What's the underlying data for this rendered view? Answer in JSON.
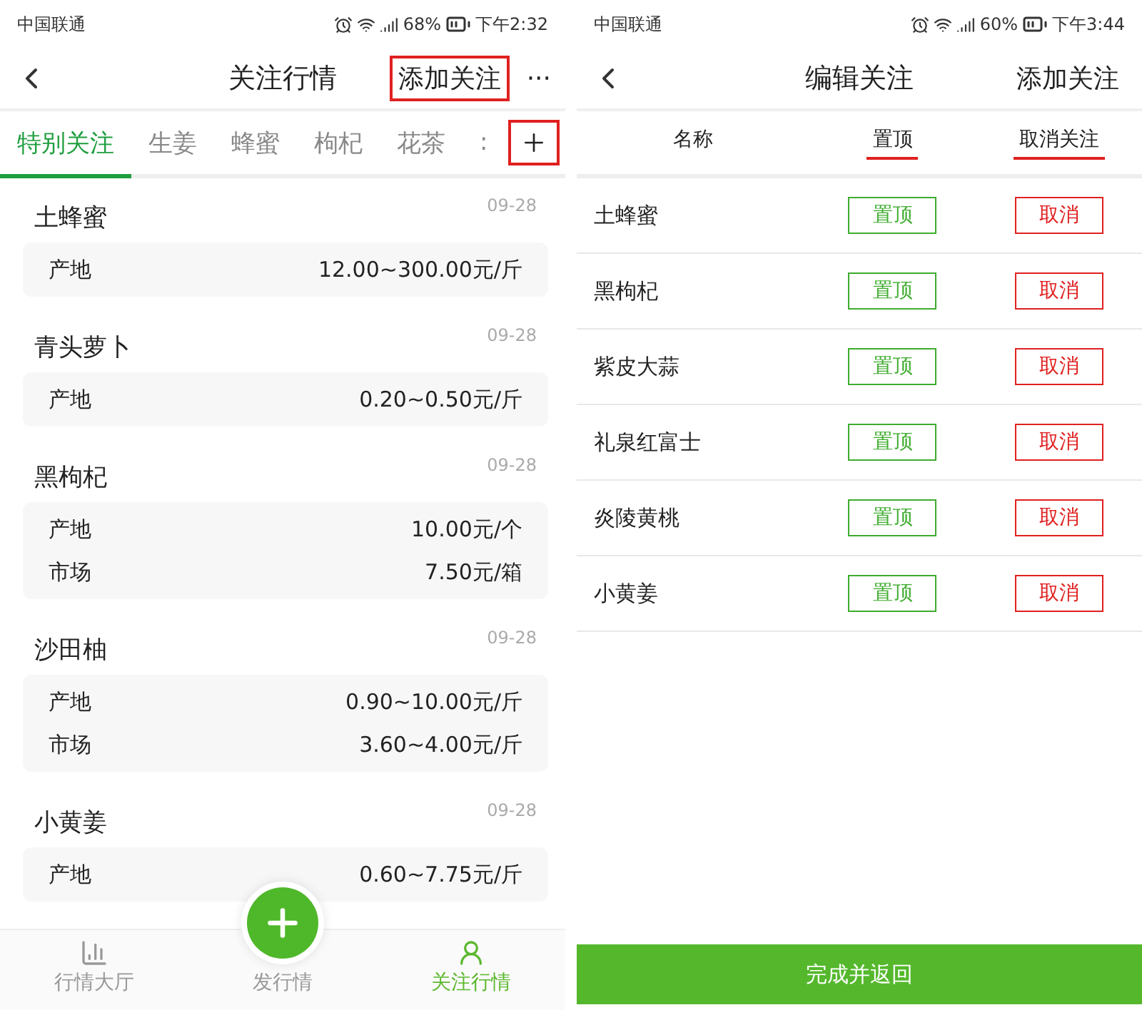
{
  "left": {
    "status_bar": {
      "carrier": "中国联通",
      "battery": "68%",
      "time": "下午2:32"
    },
    "header": {
      "title": "关注行情",
      "action": {
        "label": "添加关注",
        "highlighted": true
      },
      "more": "···"
    },
    "tabs": [
      {
        "label": "特别关注",
        "selected": true
      },
      {
        "label": "生姜",
        "selected": false
      },
      {
        "label": "蜂蜜",
        "selected": false
      },
      {
        "label": "枸杞",
        "selected": false
      },
      {
        "label": "花茶",
        "selected": false
      },
      {
        "label": ":",
        "selected": false
      }
    ],
    "add_tab": {
      "highlighted": true
    },
    "items": [
      {
        "name": "土蜂蜜",
        "date": "09-28",
        "prices": [
          {
            "label": "产地",
            "value": "12.00~300.00元/斤"
          }
        ]
      },
      {
        "name": "青头萝卜",
        "date": "09-28",
        "prices": [
          {
            "label": "产地",
            "value": "0.20~0.50元/斤"
          }
        ]
      },
      {
        "name": "黑枸杞",
        "date": "09-28",
        "prices": [
          {
            "label": "产地",
            "value": "10.00元/个"
          },
          {
            "label": "市场",
            "value": "7.50元/箱"
          }
        ]
      },
      {
        "name": "沙田柚",
        "date": "09-28",
        "prices": [
          {
            "label": "产地",
            "value": "0.90~10.00元/斤"
          },
          {
            "label": "市场",
            "value": "3.60~4.00元/斤"
          }
        ]
      },
      {
        "name": "小黄姜",
        "date": "09-28",
        "prices": [
          {
            "label": "产地",
            "value": "0.60~7.75元/斤"
          }
        ]
      }
    ],
    "nav": [
      {
        "label": "行情大厅",
        "kind": "chart",
        "selected": false
      },
      {
        "label": "发行情",
        "kind": "publish",
        "selected": false
      },
      {
        "label": "关注行情",
        "kind": "follow",
        "selected": true
      }
    ]
  },
  "right": {
    "status_bar": {
      "carrier": "中国联通",
      "battery": "60%",
      "time": "下午3:44"
    },
    "header": {
      "title": "编辑关注",
      "action": {
        "label": "添加关注",
        "highlighted": false
      }
    },
    "columns": [
      {
        "label": "名称",
        "underlined": false
      },
      {
        "label": "置顶",
        "underlined": true
      },
      {
        "label": "取消关注",
        "underlined": true
      }
    ],
    "rows": [
      {
        "name": "土蜂蜜",
        "pin": "置顶",
        "cancel": "取消"
      },
      {
        "name": "黑枸杞",
        "pin": "置顶",
        "cancel": "取消"
      },
      {
        "name": "紫皮大蒜",
        "pin": "置顶",
        "cancel": "取消"
      },
      {
        "name": "礼泉红富士",
        "pin": "置顶",
        "cancel": "取消"
      },
      {
        "name": "炎陵黄桃",
        "pin": "置顶",
        "cancel": "取消"
      },
      {
        "name": "小黄姜",
        "pin": "置顶",
        "cancel": "取消"
      }
    ],
    "footer_button": "完成并返回"
  }
}
